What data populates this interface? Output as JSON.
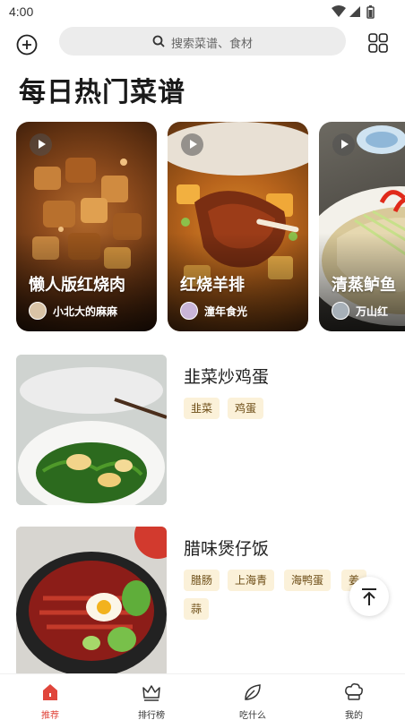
{
  "status_bar": {
    "time": "4:00"
  },
  "top_bar": {
    "search_placeholder": "搜索菜谱、食材"
  },
  "section_title": "每日热门菜谱",
  "featured": [
    {
      "title": "懒人版红烧肉",
      "author": "小北大的麻麻"
    },
    {
      "title": "红烧羊排",
      "author": "潼年食光"
    },
    {
      "title": "清蒸鲈鱼",
      "author": "万山红"
    }
  ],
  "recipes": [
    {
      "name": "韭菜炒鸡蛋",
      "tags": [
        "韭菜",
        "鸡蛋"
      ]
    },
    {
      "name": "腊味煲仔饭",
      "tags": [
        "腊肠",
        "上海青",
        "海鸭蛋",
        "姜",
        "蒜"
      ]
    }
  ],
  "bottom_nav": [
    {
      "label": "推荐",
      "icon": "home-icon",
      "active": true
    },
    {
      "label": "排行榜",
      "icon": "crown-icon",
      "active": false
    },
    {
      "label": "吃什么",
      "icon": "leaf-icon",
      "active": false
    },
    {
      "label": "我的",
      "icon": "chef-hat-icon",
      "active": false
    }
  ],
  "colors": {
    "accent": "#e0453b",
    "tag_bg": "#fbf1d9",
    "tag_text": "#6b4b14",
    "search_bg": "#ececec"
  }
}
